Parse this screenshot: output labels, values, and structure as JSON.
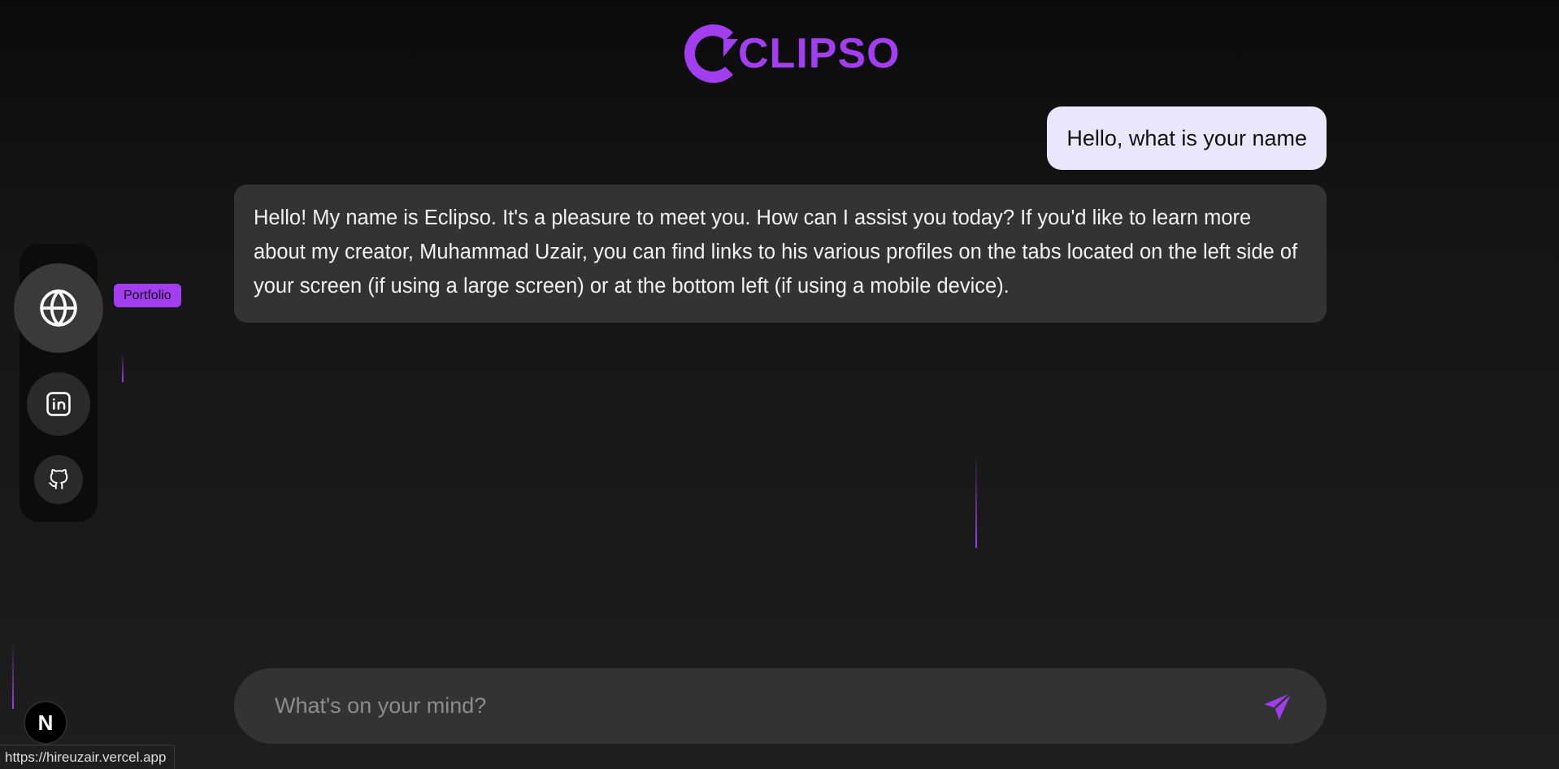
{
  "brand": {
    "name": "CLIPSO",
    "accent": "#a33df0"
  },
  "chat": {
    "user_message": "Hello, what is your name",
    "bot_message": "Hello! My name is Eclipso. It's a pleasure to meet you. How can I assist you today? If you'd like to learn more about my creator, Muhammad Uzair, you can find links to his various profiles on the tabs located on the left side of your screen (if using a large screen) or at the bottom left (if using a mobile device)."
  },
  "sidebar": {
    "items": [
      {
        "id": "portfolio",
        "icon": "globe-icon"
      },
      {
        "id": "linkedin",
        "icon": "linkedin-icon"
      },
      {
        "id": "github",
        "icon": "github-icon"
      }
    ],
    "tooltip": "Portfolio"
  },
  "input": {
    "placeholder": "What's on your mind?",
    "value": "",
    "send_icon": "send-icon"
  },
  "badge": {
    "letter": "N"
  },
  "status": {
    "url": "https://hireuzair.vercel.app"
  }
}
